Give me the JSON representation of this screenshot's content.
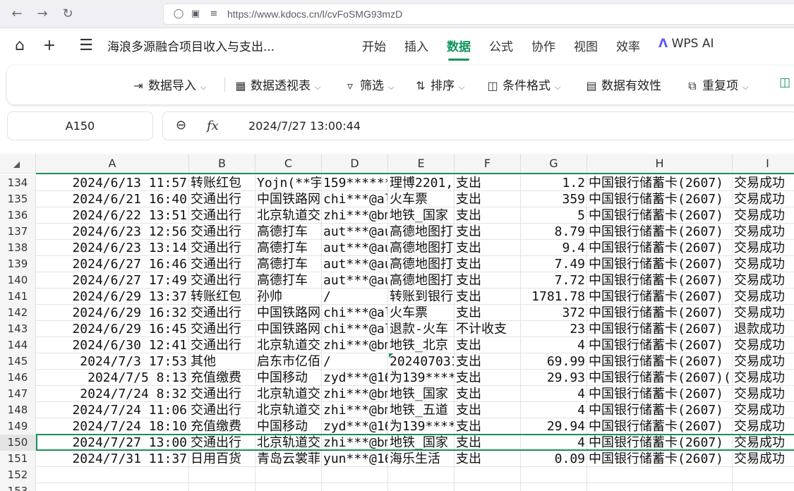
{
  "browser": {
    "url": "https://www.kdocs.cn/l/cvFoSMG93mzD",
    "back_icon": "arrow-left-icon",
    "forward_icon": "arrow-right-icon",
    "reload_icon": "reload-icon"
  },
  "app": {
    "doc_title": "海浪多源融合项目收入与支出...",
    "menu_tabs": [
      {
        "label": "开始",
        "active": false
      },
      {
        "label": "插入",
        "active": false
      },
      {
        "label": "数据",
        "active": true
      },
      {
        "label": "公式",
        "active": false
      },
      {
        "label": "协作",
        "active": false
      },
      {
        "label": "视图",
        "active": false
      },
      {
        "label": "效率",
        "active": false
      },
      {
        "label": "WPS AI",
        "active": false
      }
    ],
    "accent_color": "#11955d"
  },
  "toolbar": {
    "import_label": "数据导入",
    "pivot_label": "数据透视表",
    "filter_label": "筛选",
    "sort_label": "排序",
    "condformat_label": "条件格式",
    "validity_label": "数据有效性",
    "duplicate_label": "重复项"
  },
  "formula": {
    "name_box": "A150",
    "value": "2024/7/27 13:00:44",
    "fx_label": "fx"
  },
  "sheet": {
    "columns": [
      "A",
      "B",
      "C",
      "D",
      "E",
      "F",
      "G",
      "H",
      "I"
    ],
    "selected_row": "150",
    "rows": [
      {
        "num": "134",
        "cells": [
          "2024/6/13 11:57",
          "转账红包",
          "Yojn(**宇",
          "159*******",
          "理博2201,",
          "支出",
          "1.2",
          "中国银行储蓄卡(2607)",
          "交易成功"
        ]
      },
      {
        "num": "135",
        "cells": [
          "2024/6/21 16:40",
          "交通出行",
          "中国铁路网",
          "chi***@al",
          "火车票",
          "支出",
          "359",
          "中国银行储蓄卡(2607)",
          "交易成功"
        ]
      },
      {
        "num": "136",
        "cells": [
          "2024/6/22 13:51",
          "交通出行",
          "北京轨道交",
          "zhi***@bm",
          "地铁_国家",
          "支出",
          "5",
          "中国银行储蓄卡(2607)",
          "交易成功"
        ]
      },
      {
        "num": "137",
        "cells": [
          "2024/6/23 12:56",
          "交通出行",
          "高德打车",
          "aut***@au",
          "高德地图打",
          "支出",
          "8.79",
          "中国银行储蓄卡(2607)",
          "交易成功"
        ]
      },
      {
        "num": "138",
        "cells": [
          "2024/6/23 13:14",
          "交通出行",
          "高德打车",
          "aut***@au",
          "高德地图打",
          "支出",
          "9.4",
          "中国银行储蓄卡(2607)",
          "交易成功"
        ]
      },
      {
        "num": "139",
        "cells": [
          "2024/6/27 16:46",
          "交通出行",
          "高德打车",
          "aut***@au",
          "高德地图打",
          "支出",
          "7.49",
          "中国银行储蓄卡(2607)",
          "交易成功"
        ]
      },
      {
        "num": "140",
        "cells": [
          "2024/6/27 17:49",
          "交通出行",
          "高德打车",
          "aut***@au",
          "高德地图打",
          "支出",
          "7.72",
          "中国银行储蓄卡(2607)",
          "交易成功"
        ]
      },
      {
        "num": "141",
        "cells": [
          "2024/6/29 13:37",
          "转账红包",
          "孙帅",
          "/",
          "转账到银行",
          "支出",
          "1781.78",
          "中国银行储蓄卡(2607)",
          "交易成功"
        ]
      },
      {
        "num": "142",
        "cells": [
          "2024/6/29 16:32",
          "交通出行",
          "中国铁路网",
          "chi***@al",
          "火车票",
          "支出",
          "372",
          "中国银行储蓄卡(2607)",
          "交易成功"
        ]
      },
      {
        "num": "143",
        "cells": [
          "2024/6/29 16:45",
          "交通出行",
          "中国铁路网",
          "chi***@al",
          "退款-火车",
          "不计收支",
          "23",
          "中国银行储蓄卡(2607)",
          "退款成功"
        ]
      },
      {
        "num": "144",
        "cells": [
          "2024/6/30 12:41",
          "交通出行",
          "北京轨道交",
          "zhi***@bm",
          "地铁_北京",
          "支出",
          "4",
          "中国银行储蓄卡(2607)",
          "交易成功"
        ]
      },
      {
        "num": "145",
        "cells": [
          "2024/7/3 17:53",
          "其他",
          "启东市亿佰",
          "/",
          "202407031",
          "支出",
          "69.99",
          "中国银行储蓄卡(2607)",
          "交易成功"
        ]
      },
      {
        "num": "146",
        "cells": [
          "2024/7/5 8:13",
          "充值缴费",
          "中国移动",
          "zyd***@16",
          "为139****",
          "支出",
          "29.93",
          "中国银行储蓄卡(2607)(",
          "交易成功"
        ]
      },
      {
        "num": "147",
        "cells": [
          "2024/7/24 8:32",
          "交通出行",
          "北京轨道交",
          "zhi***@bm",
          "地铁_国家",
          "支出",
          "4",
          "中国银行储蓄卡(2607)",
          "交易成功"
        ]
      },
      {
        "num": "148",
        "cells": [
          "2024/7/24 11:06",
          "交通出行",
          "北京轨道交",
          "zhi***@bm",
          "地铁_五道",
          "支出",
          "4",
          "中国银行储蓄卡(2607)",
          "交易成功"
        ]
      },
      {
        "num": "149",
        "cells": [
          "2024/7/24 18:10",
          "充值缴费",
          "中国移动",
          "zyd***@16",
          "为139****",
          "支出",
          "29.94",
          "中国银行储蓄卡(2607)",
          "交易成功"
        ]
      },
      {
        "num": "150",
        "cells": [
          "2024/7/27 13:00",
          "交通出行",
          "北京轨道交",
          "zhi***@bm",
          "地铁_国家",
          "支出",
          "4",
          "中国银行储蓄卡(2607)",
          "交易成功"
        ]
      },
      {
        "num": "151",
        "cells": [
          "2024/7/31 11:37",
          "日用百货",
          "青岛云裳菲",
          "yun***@16",
          "海乐生活",
          "支出",
          "0.09",
          "中国银行储蓄卡(2607)",
          "交易成功"
        ]
      },
      {
        "num": "152",
        "cells": [
          "",
          "",
          "",
          "",
          "",
          "",
          "",
          "",
          ""
        ]
      },
      {
        "num": "153",
        "cells": [
          "",
          "",
          "",
          "",
          "",
          "",
          "",
          "",
          ""
        ]
      }
    ]
  }
}
